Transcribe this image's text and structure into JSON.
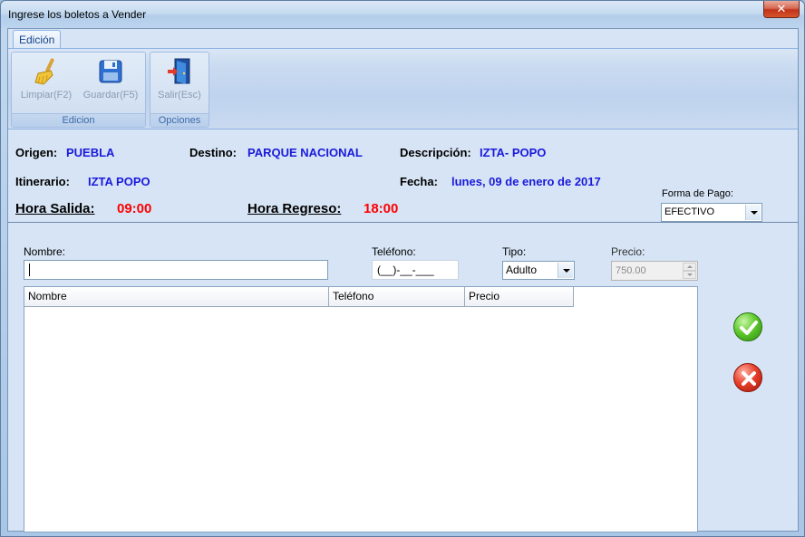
{
  "window": {
    "title": "Ingrese los boletos a Vender",
    "close_label": "✕"
  },
  "ribbon": {
    "tab_label": "Edición",
    "groups": [
      {
        "label": "Edicion",
        "buttons": [
          {
            "label": "Limpiar(F2)",
            "icon": "broom-icon"
          },
          {
            "label": "Guardar(F5)",
            "icon": "floppy-disk-icon"
          }
        ]
      },
      {
        "label": "Opciones",
        "buttons": [
          {
            "label": "Salir(Esc)",
            "icon": "exit-door-icon"
          }
        ]
      }
    ]
  },
  "trip": {
    "origen_label": "Origen:",
    "origen": "PUEBLA",
    "destino_label": "Destino:",
    "destino": "PARQUE NACIONAL",
    "descripcion_label": "Descripción:",
    "descripcion": "IZTA- POPO",
    "itinerario_label": "Itinerario:",
    "itinerario": "IZTA POPO",
    "fecha_label": "Fecha:",
    "fecha": "lunes, 09 de enero de 2017",
    "hora_salida_label": "Hora Salida:",
    "hora_salida": "09:00",
    "hora_regreso_label": "Hora Regreso:",
    "hora_regreso": "18:00",
    "forma_pago_label": "Forma de Pago:",
    "forma_pago": "EFECTIVO"
  },
  "form": {
    "nombre_label": "Nombre:",
    "nombre_value": "",
    "telefono_label": "Teléfono:",
    "telefono_mask": "(__)-__-___",
    "tipo_label": "Tipo:",
    "tipo_value": "Adulto",
    "precio_label": "Precio:",
    "precio_value": "750.00"
  },
  "grid": {
    "columns": [
      "Nombre",
      "Teléfono",
      "Precio"
    ],
    "rows": []
  },
  "colors": {
    "value_blue": "#1a1adb",
    "time_red": "#ff0000",
    "accent": "#15428b"
  }
}
